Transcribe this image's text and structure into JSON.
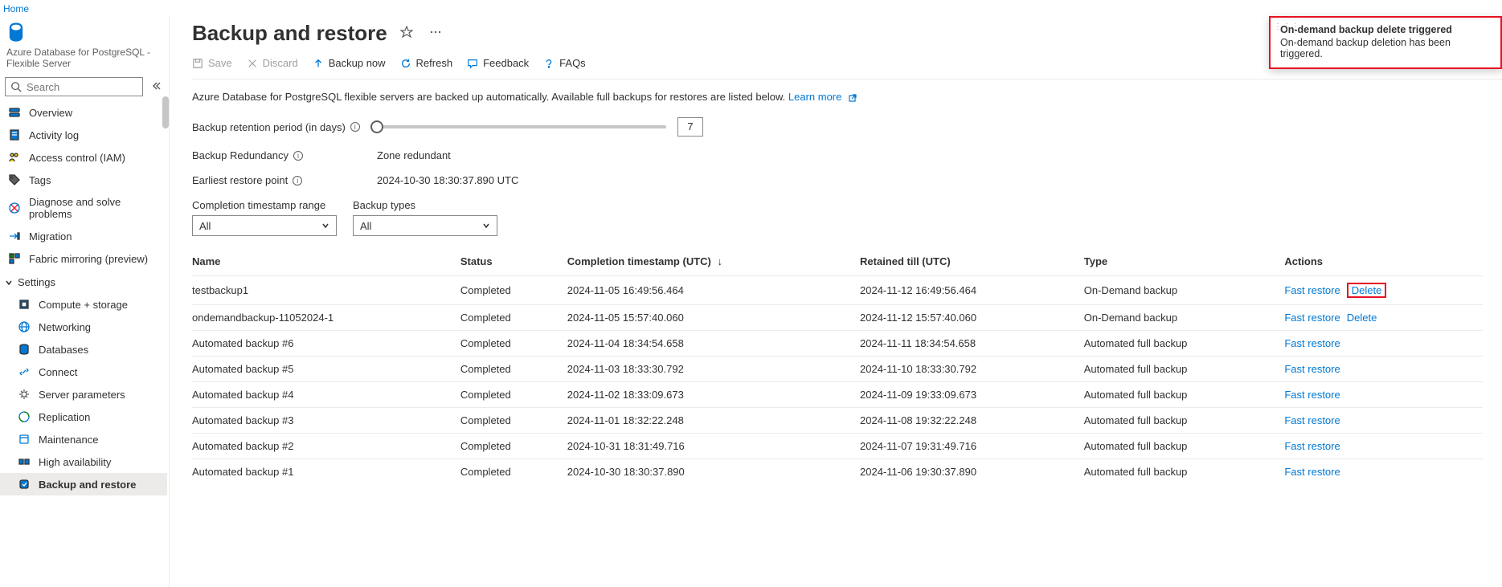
{
  "breadcrumb": {
    "home": "Home"
  },
  "resource": {
    "subtitle": "Azure Database for PostgreSQL - Flexible Server"
  },
  "search": {
    "placeholder": "Search"
  },
  "sidebar": {
    "items": [
      {
        "label": "Overview",
        "icon": "server"
      },
      {
        "label": "Activity log",
        "icon": "log"
      },
      {
        "label": "Access control (IAM)",
        "icon": "iam"
      },
      {
        "label": "Tags",
        "icon": "tag"
      },
      {
        "label": "Diagnose and solve problems",
        "icon": "diagnose"
      },
      {
        "label": "Migration",
        "icon": "migration"
      },
      {
        "label": "Fabric mirroring (preview)",
        "icon": "fabric"
      }
    ],
    "settings_label": "Settings",
    "settings": [
      {
        "label": "Compute + storage",
        "icon": "compute"
      },
      {
        "label": "Networking",
        "icon": "network"
      },
      {
        "label": "Databases",
        "icon": "db"
      },
      {
        "label": "Connect",
        "icon": "connect"
      },
      {
        "label": "Server parameters",
        "icon": "params"
      },
      {
        "label": "Replication",
        "icon": "repl"
      },
      {
        "label": "Maintenance",
        "icon": "maint"
      },
      {
        "label": "High availability",
        "icon": "ha"
      },
      {
        "label": "Backup and restore",
        "icon": "backup",
        "active": true
      }
    ]
  },
  "page": {
    "title": "Backup and restore"
  },
  "toolbar": {
    "save": "Save",
    "discard": "Discard",
    "backup_now": "Backup now",
    "refresh": "Refresh",
    "feedback": "Feedback",
    "faqs": "FAQs"
  },
  "intro": {
    "text": "Azure Database for PostgreSQL flexible servers are backed up automatically. Available full backups for restores are listed below.",
    "link": "Learn more"
  },
  "form": {
    "retention_label": "Backup retention period (in days)",
    "retention_value": "7",
    "redundancy_label": "Backup Redundancy",
    "redundancy_value": "Zone redundant",
    "earliest_label": "Earliest restore point",
    "earliest_value": "2024-10-30 18:30:37.890 UTC"
  },
  "filters": {
    "timestamp_label": "Completion timestamp range",
    "timestamp_value": "All",
    "types_label": "Backup types",
    "types_value": "All"
  },
  "table": {
    "headers": {
      "name": "Name",
      "status": "Status",
      "completion": "Completion timestamp (UTC)",
      "retained": "Retained till (UTC)",
      "type": "Type",
      "actions": "Actions"
    },
    "action_labels": {
      "fast_restore": "Fast restore",
      "delete": "Delete"
    },
    "rows": [
      {
        "name": "testbackup1",
        "status": "Completed",
        "completion": "2024-11-05 16:49:56.464",
        "retained": "2024-11-12 16:49:56.464",
        "type": "On-Demand backup",
        "has_delete": true,
        "highlight_delete": true
      },
      {
        "name": "ondemandbackup-11052024-1",
        "status": "Completed",
        "completion": "2024-11-05 15:57:40.060",
        "retained": "2024-11-12 15:57:40.060",
        "type": "On-Demand backup",
        "has_delete": true
      },
      {
        "name": "Automated backup #6",
        "status": "Completed",
        "completion": "2024-11-04 18:34:54.658",
        "retained": "2024-11-11 18:34:54.658",
        "type": "Automated full backup"
      },
      {
        "name": "Automated backup #5",
        "status": "Completed",
        "completion": "2024-11-03 18:33:30.792",
        "retained": "2024-11-10 18:33:30.792",
        "type": "Automated full backup"
      },
      {
        "name": "Automated backup #4",
        "status": "Completed",
        "completion": "2024-11-02 18:33:09.673",
        "retained": "2024-11-09 19:33:09.673",
        "type": "Automated full backup"
      },
      {
        "name": "Automated backup #3",
        "status": "Completed",
        "completion": "2024-11-01 18:32:22.248",
        "retained": "2024-11-08 19:32:22.248",
        "type": "Automated full backup"
      },
      {
        "name": "Automated backup #2",
        "status": "Completed",
        "completion": "2024-10-31 18:31:49.716",
        "retained": "2024-11-07 19:31:49.716",
        "type": "Automated full backup"
      },
      {
        "name": "Automated backup #1",
        "status": "Completed",
        "completion": "2024-10-30 18:30:37.890",
        "retained": "2024-11-06 19:30:37.890",
        "type": "Automated full backup"
      }
    ]
  },
  "toast": {
    "title": "On-demand backup delete triggered",
    "body": "On-demand backup deletion has been triggered."
  }
}
